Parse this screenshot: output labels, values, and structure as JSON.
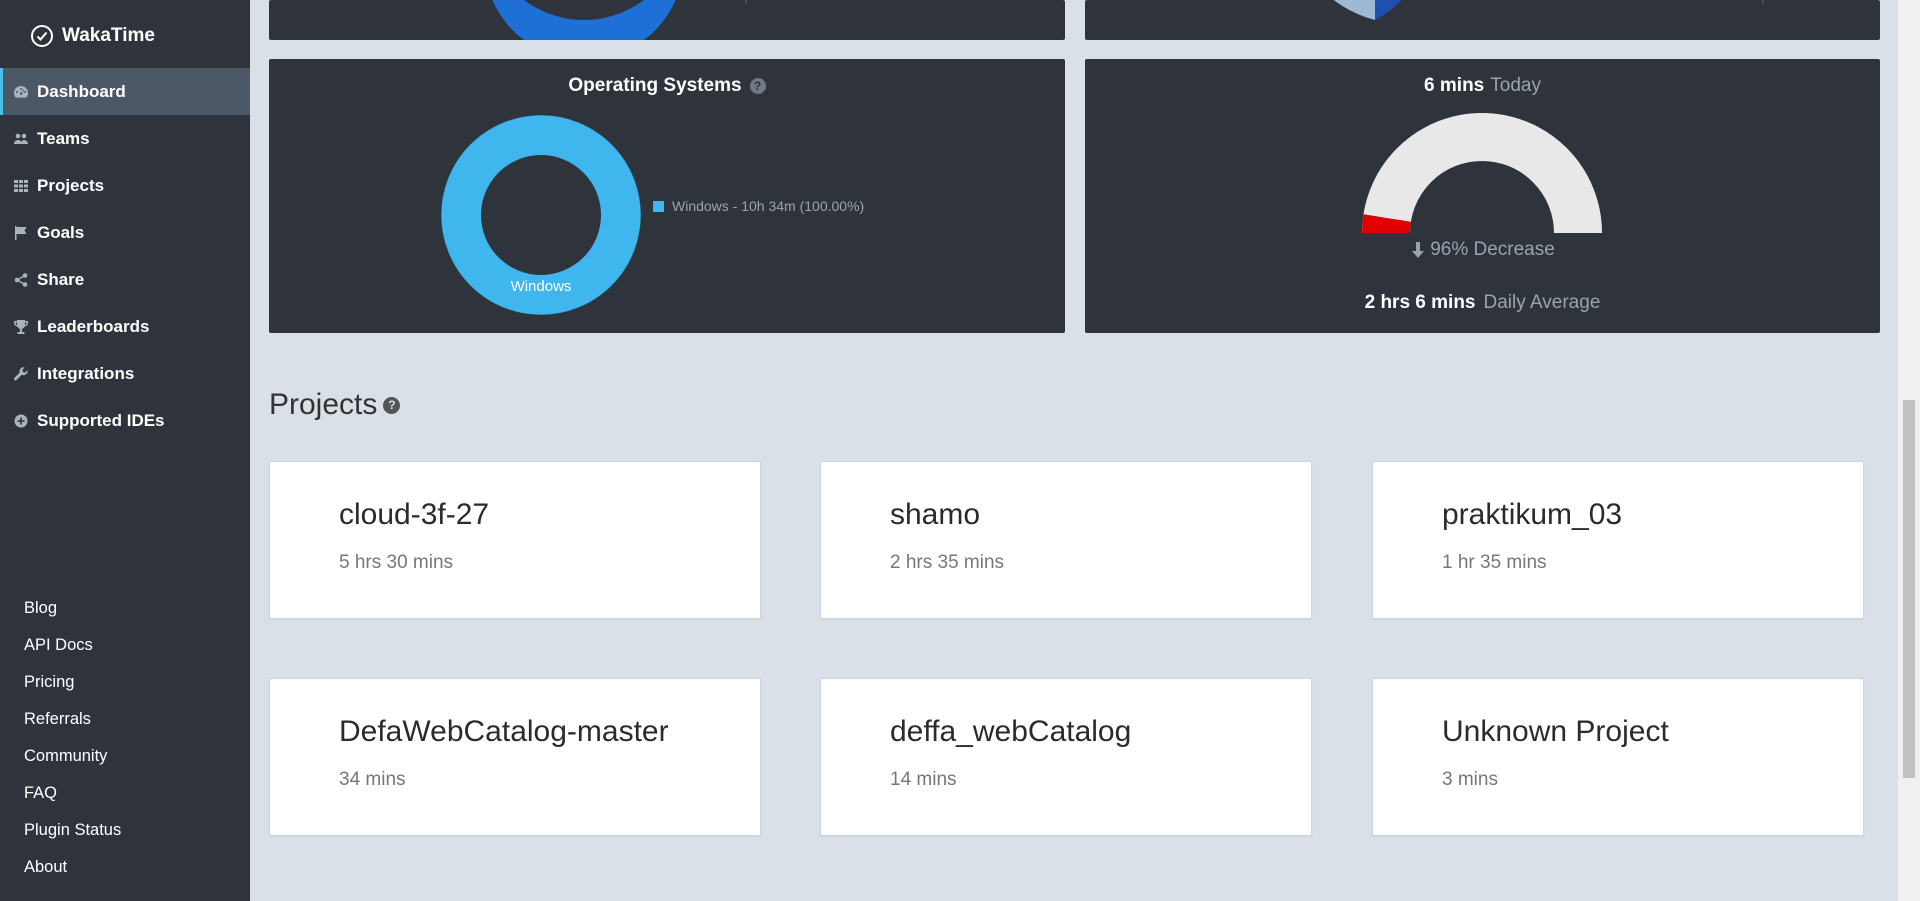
{
  "app": {
    "brand": "WakaTime"
  },
  "sidebar": {
    "nav": [
      {
        "label": "Dashboard",
        "icon": "dashboard-icon"
      },
      {
        "label": "Teams",
        "icon": "users-icon"
      },
      {
        "label": "Projects",
        "icon": "grid-icon"
      },
      {
        "label": "Goals",
        "icon": "flag-icon"
      },
      {
        "label": "Share",
        "icon": "share-icon"
      },
      {
        "label": "Leaderboards",
        "icon": "trophy-icon"
      },
      {
        "label": "Integrations",
        "icon": "wrench-icon"
      },
      {
        "label": "Supported IDEs",
        "icon": "plus-circle-icon"
      }
    ],
    "footer": [
      "Blog",
      "API Docs",
      "Pricing",
      "Referrals",
      "Community",
      "FAQ",
      "Plugin Status",
      "About"
    ]
  },
  "os_card": {
    "title": "Operating Systems",
    "donut_label": "Windows",
    "legend": "Windows - 10h 34m (100.00%)",
    "color": "#3fb6ee"
  },
  "today_card": {
    "today_value": "6 mins",
    "today_label": "Today",
    "change": "96% Decrease",
    "avg_value": "2 hrs 6 mins",
    "avg_label": "Daily Average",
    "gauge_fraction": 0.05,
    "gauge_color": "#e00000",
    "gauge_bg": "#e8e8e8"
  },
  "projects": {
    "heading": "Projects",
    "items": [
      {
        "name": "cloud-3f-27",
        "time": "5 hrs 30 mins"
      },
      {
        "name": "shamo",
        "time": "2 hrs 35 mins"
      },
      {
        "name": "praktikum_03",
        "time": "1 hr 35 mins"
      },
      {
        "name": "DefaWebCatalog-master",
        "time": "34 mins"
      },
      {
        "name": "deffa_webCatalog",
        "time": "14 mins"
      },
      {
        "name": "Unknown Project",
        "time": "3 mins"
      }
    ]
  },
  "colors": {
    "sidebar": "#2f343c",
    "active": "#4d5866",
    "accent": "#4ac0ec",
    "page": "#dae0e8"
  }
}
